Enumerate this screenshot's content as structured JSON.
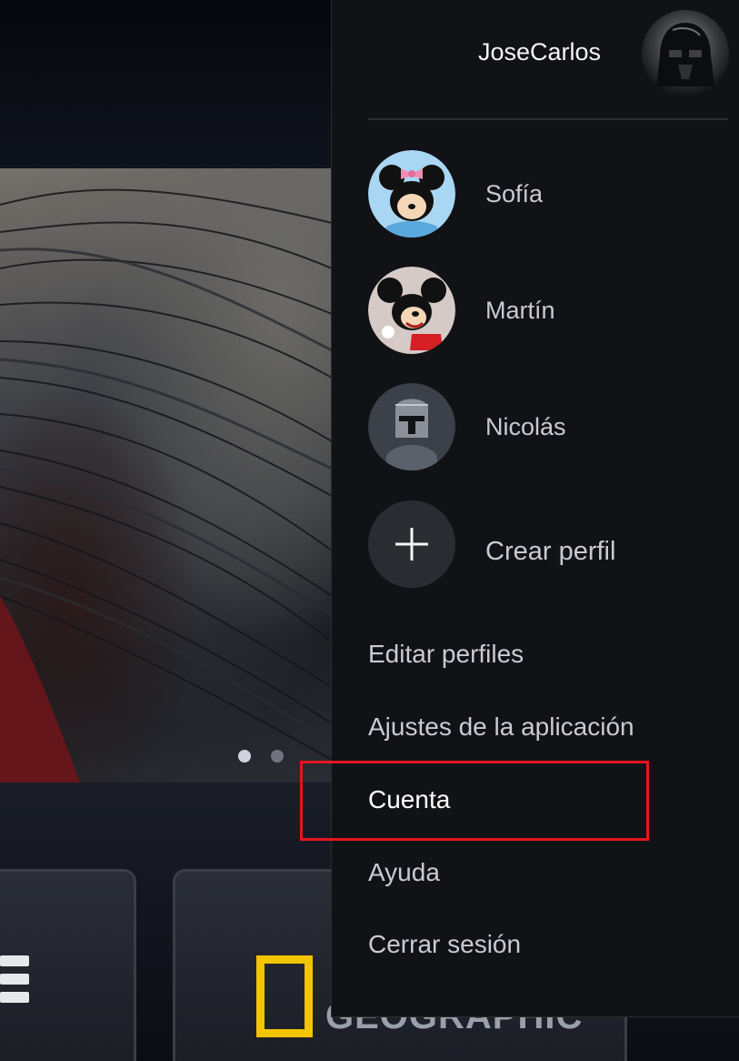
{
  "current_profile": {
    "name": "JoseCarlos",
    "avatar_icon": "darth-vader-avatar-icon"
  },
  "profiles": [
    {
      "name": "Sofía",
      "avatar_icon": "minnie-mouse-avatar-icon"
    },
    {
      "name": "Martín",
      "avatar_icon": "mickey-mouse-avatar-icon"
    },
    {
      "name": "Nicolás",
      "avatar_icon": "mandalorian-avatar-icon"
    }
  ],
  "create_profile": {
    "label": "Crear perfil",
    "icon": "plus-icon"
  },
  "menu_items": [
    {
      "label": "Editar perfiles"
    },
    {
      "label": "Ajustes de la aplicación"
    },
    {
      "label": "Cuenta",
      "highlighted": true
    },
    {
      "label": "Ayuda"
    },
    {
      "label": "Cerrar sesión"
    }
  ],
  "brand_tiles": {
    "national_geographic_text": "GEOGRAPHIC"
  },
  "hero": {
    "carousel_dots": 2,
    "active_dot": 1
  },
  "colors": {
    "menu_bg": "#111216",
    "highlight_border": "#e3161e",
    "natgeo_yellow": "#f3c400"
  }
}
